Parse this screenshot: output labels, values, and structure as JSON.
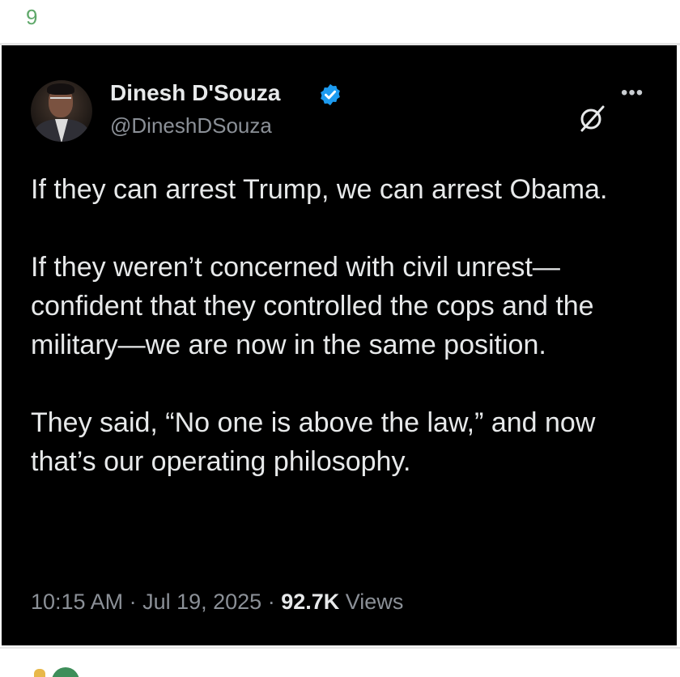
{
  "index_label": "9",
  "tweet": {
    "author_name": "Dinesh D'Souza",
    "author_handle": "@DineshDSouza",
    "paragraphs": [
      "If they can arrest Trump, we can arrest Obama.",
      "If they weren’t concerned with civil unrest—confident that they controlled the cops and the military—we are now in the same position.",
      "They said, “No one is above the law,” and now that’s our operating philosophy."
    ],
    "time": "10:15 AM",
    "date": "Jul 19, 2025",
    "views_count": "92.7K",
    "views_label": "Views"
  },
  "icons": {
    "verified": "verified-badge-icon",
    "grok": "grok-icon",
    "more": "more-options-icon"
  },
  "colors": {
    "card_bg": "#000000",
    "text_primary": "#e7e9ea",
    "text_secondary": "#8b9097",
    "verified_blue": "#1d9bf0",
    "index_green": "#5fa86a"
  }
}
